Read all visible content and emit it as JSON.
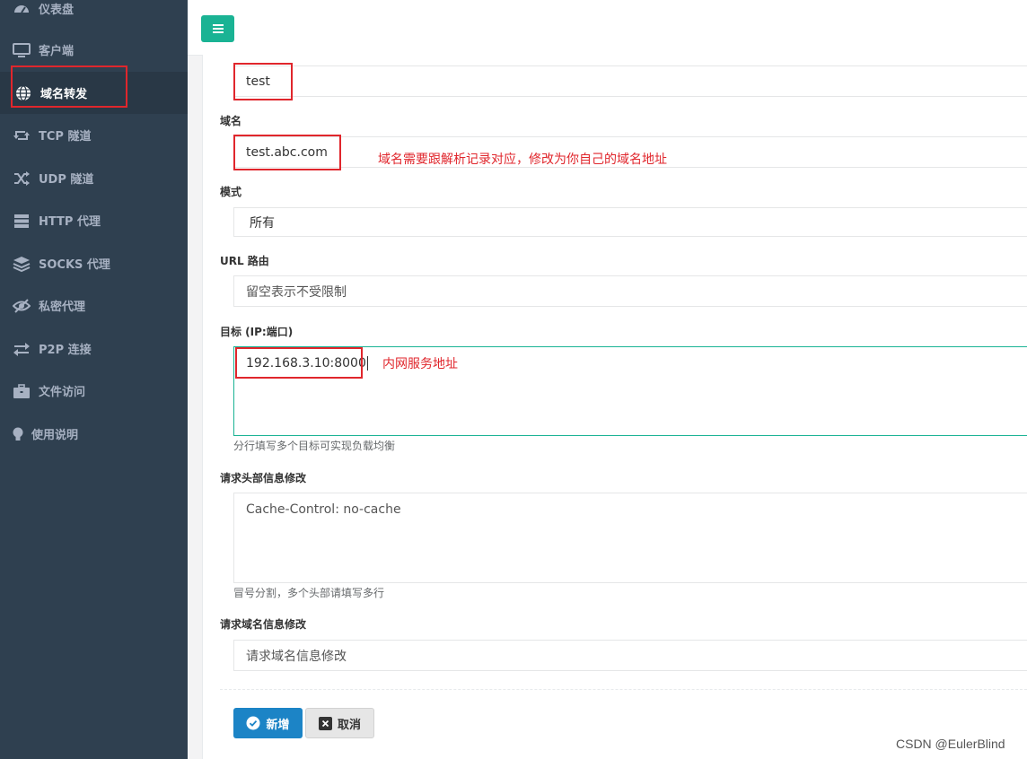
{
  "sidebar": {
    "items": [
      {
        "label": "仪表盘",
        "icon": "dashboard-icon"
      },
      {
        "label": "客户端",
        "icon": "monitor-icon"
      },
      {
        "label": "域名转发",
        "icon": "globe-icon",
        "active": true
      },
      {
        "label": "TCP 隧道",
        "icon": "retweet-icon"
      },
      {
        "label": "UDP 隧道",
        "icon": "shuffle-icon"
      },
      {
        "label": "HTTP 代理",
        "icon": "server-icon"
      },
      {
        "label": "SOCKS 代理",
        "icon": "layers-icon"
      },
      {
        "label": "私密代理",
        "icon": "eye-slash-icon"
      },
      {
        "label": "P2P 连接",
        "icon": "exchange-icon"
      },
      {
        "label": "文件访问",
        "icon": "briefcase-icon"
      },
      {
        "label": "使用说明",
        "icon": "lightbulb-icon"
      }
    ]
  },
  "form": {
    "remark_value": "test",
    "domain_label": "域名",
    "domain_value": "test.abc.com",
    "domain_note": "域名需要跟解析记录对应，修改为你自己的域名地址",
    "mode_label": "模式",
    "mode_value": "所有",
    "url_label": "URL 路由",
    "url_placeholder": "留空表示不受限制",
    "target_label": "目标 (IP:端口)",
    "target_value": "192.168.3.10:8000",
    "target_note": "内网服务地址",
    "target_help": "分行填写多个目标可实现负载均衡",
    "header_label": "请求头部信息修改",
    "header_placeholder": "Cache-Control: no-cache",
    "header_help": "冒号分割，多个头部请填写多行",
    "host_label": "请求域名信息修改",
    "host_placeholder": "请求域名信息修改",
    "submit_label": "新增",
    "cancel_label": "取消"
  },
  "colors": {
    "sidebar_bg": "#2f4050",
    "accent_green": "#1ab394",
    "primary_blue": "#1c84c6",
    "annotation_red": "#e0262c"
  },
  "watermark": "CSDN @EulerBlind"
}
